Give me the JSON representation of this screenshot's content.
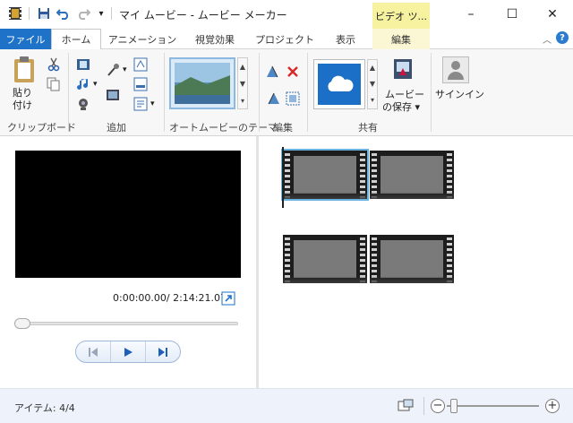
{
  "window": {
    "title": "マイ ムービー - ムービー メーカー",
    "contextual_tab_group": "ビデオ ツ...",
    "controls": {
      "minimize": "–",
      "maximize": "☐",
      "close": "✕"
    }
  },
  "ribbon": {
    "tabs": [
      {
        "label": "ファイル"
      },
      {
        "label": "ホーム"
      },
      {
        "label": "アニメーション"
      },
      {
        "label": "視覚効果"
      },
      {
        "label": "プロジェクト"
      },
      {
        "label": "表示"
      },
      {
        "label": "編集"
      }
    ],
    "active_tab": "ホーム",
    "groups": {
      "clipboard": {
        "label": "クリップボード",
        "paste_label_1": "貼り",
        "paste_label_2": "付け"
      },
      "add": {
        "label": "追加"
      },
      "automovie": {
        "label": "オートムービーのテーマ"
      },
      "edit": {
        "label": "編集"
      },
      "share": {
        "label": "共有",
        "save_movie_1": "ムービー",
        "save_movie_2": "の保存 ▾"
      },
      "signin": {
        "label": "サインイン"
      }
    }
  },
  "preview": {
    "time": "0:00:00.00/ 2:14:21.07"
  },
  "status": {
    "items": "アイテム: 4/4"
  },
  "zoom": {
    "level": 0.05
  },
  "colors": {
    "file_tab": "#1e72c8",
    "context_tab": "#f6f2a0",
    "onedrive": "#1c6fc6"
  }
}
